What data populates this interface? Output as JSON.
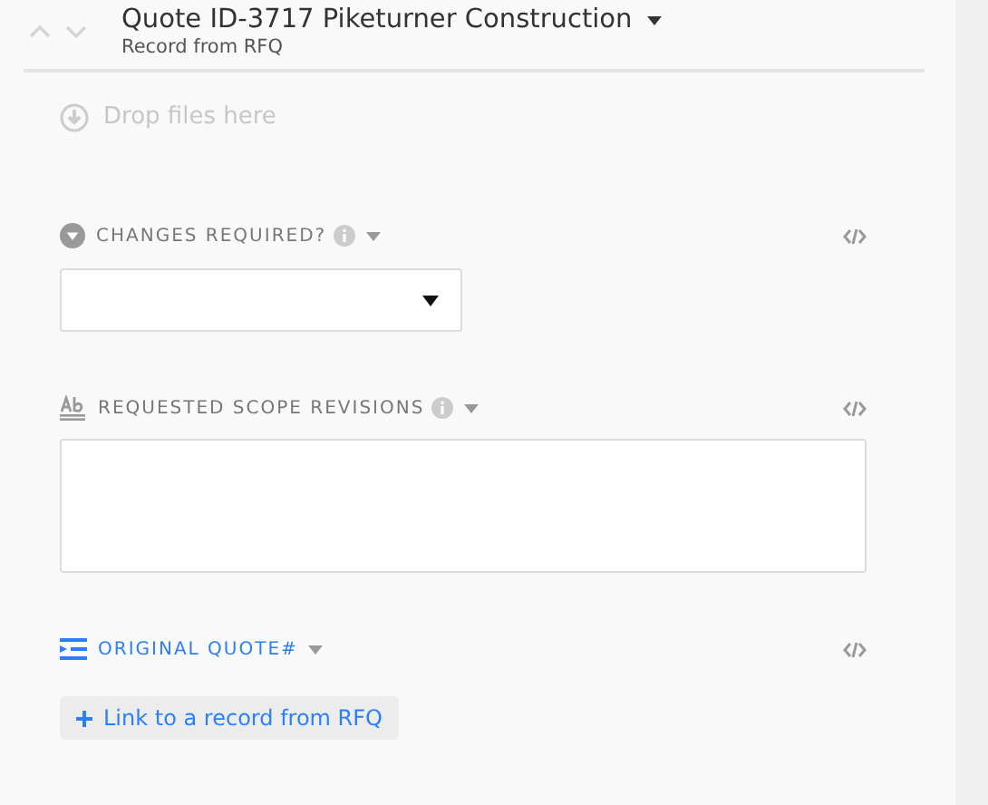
{
  "record": {
    "title": "Quote ID-3717 Piketurner Construction",
    "subtitle": "Record from RFQ"
  },
  "dropzone": {
    "label": "Drop files here"
  },
  "fields": [
    {
      "kind": "select",
      "label": "CHANGES REQUIRED?",
      "info": true,
      "highlighted": false
    },
    {
      "kind": "textarea",
      "label": "REQUESTED SCOPE REVISIONS",
      "info": true,
      "highlighted": false
    },
    {
      "kind": "link",
      "label": "ORIGINAL QUOTE#",
      "info": false,
      "highlighted": true,
      "button": "Link to a record from RFQ"
    }
  ]
}
